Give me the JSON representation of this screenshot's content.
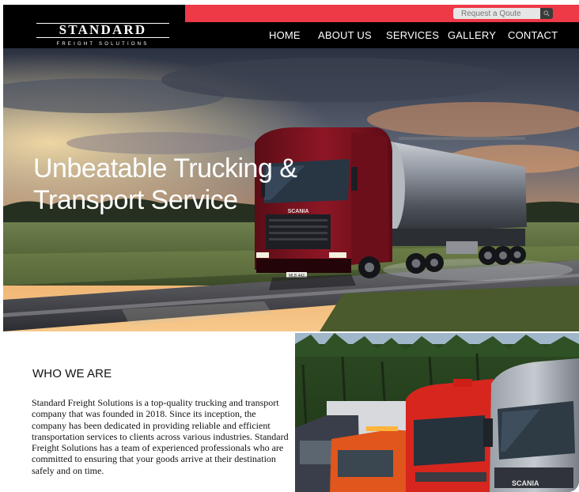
{
  "brand": {
    "name": "STANDARD",
    "tagline": "FREIGHT SOLUTIONS"
  },
  "quote": {
    "placeholder": "Request a Qoute",
    "icon": "search-icon"
  },
  "nav": {
    "items": [
      {
        "label": "HOME"
      },
      {
        "label": "ABOUT US"
      },
      {
        "label": "SERVICES"
      },
      {
        "label": "GALLERY"
      },
      {
        "label": "CONTACT"
      }
    ]
  },
  "hero": {
    "title_line1": "Unbeatable Trucking &",
    "title_line2": "Transport Service",
    "truck_brand": "SCANIA",
    "plate": "MLB 442"
  },
  "about": {
    "heading": "WHO WE ARE",
    "body": "Standard Freight Solutions is a top-quality trucking and transport company that was founded in 2018. Since its inception, the company has been dedicated in providing reliable and efficient transportation services to clients across various industries. Standard Freight Solutions has a team of experienced professionals who are committed to ensuring that your goods arrive at their destination safely and on time.",
    "truck_brand": "SCANIA"
  },
  "colors": {
    "accent": "#ee3947",
    "header_bg": "#000000",
    "search_button": "#3a3a3a"
  }
}
